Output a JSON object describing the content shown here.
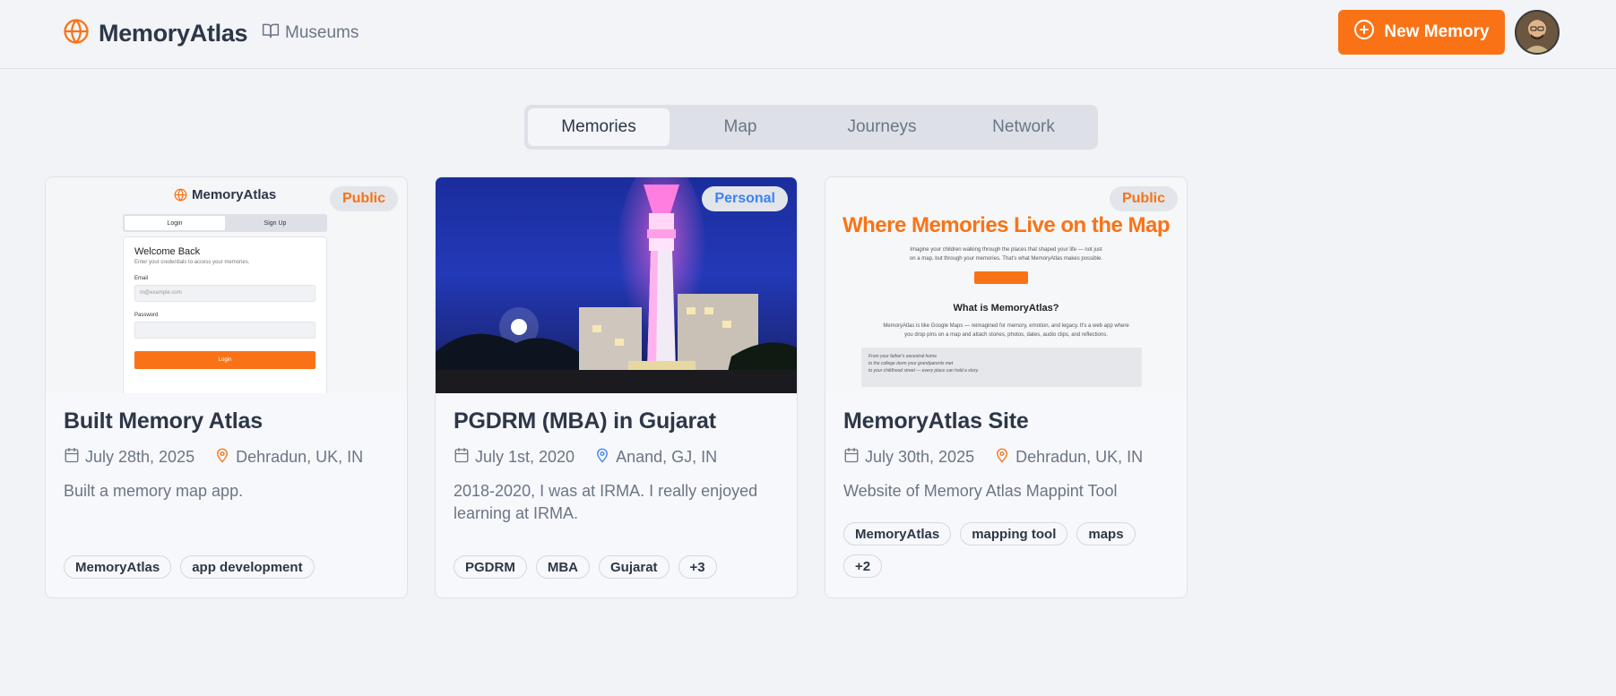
{
  "app": {
    "title": "MemoryAtlas",
    "nav_museums": "Museums",
    "new_memory": "New Memory"
  },
  "tabs": [
    "Memories",
    "Map",
    "Journeys",
    "Network"
  ],
  "active_tab": "Memories",
  "colors": {
    "accent": "#f97316",
    "personal": "#3b82f6"
  },
  "cards": [
    {
      "title": "Built Memory Atlas",
      "date": "July 28th, 2025",
      "location": "Dehradun, UK, IN",
      "description": "Built a memory map app.",
      "visibility": "Public",
      "tags": [
        "MemoryAtlas",
        "app development"
      ],
      "preview": {
        "logo": "MemoryAtlas",
        "tab_login": "Login",
        "tab_signup": "Sign Up",
        "heading": "Welcome Back",
        "subheading": "Enter your credentials to access your memories.",
        "email_label": "Email",
        "email_placeholder": "m@example.com",
        "password_label": "Password",
        "button": "Login"
      }
    },
    {
      "title": "PGDRM (MBA) in Gujarat",
      "date": "July 1st, 2020",
      "location": "Anand, GJ, IN",
      "description": "2018-2020, I was at IRMA. I really enjoyed learning at IRMA.",
      "visibility": "Personal",
      "tags": [
        "PGDRM",
        "MBA",
        "Gujarat",
        "+3"
      ]
    },
    {
      "title": "MemoryAtlas Site",
      "date": "July 30th, 2025",
      "location": "Dehradun, UK, IN",
      "description": "Website of Memory Atlas Mappint Tool",
      "visibility": "Public",
      "tags": [
        "MemoryAtlas",
        "mapping tool",
        "maps",
        "+2"
      ],
      "preview": {
        "hero": "Where Memories Live on the Map",
        "line1": "Imagine your children walking through the places that shaped your life — not just",
        "line2": "on a map, but through your memories. That's what MemoryAtlas makes possible.",
        "section": "What is MemoryAtlas?",
        "body1": "MemoryAtlas is like Google Maps — reimagined for memory, emotion, and legacy. It's a web app where",
        "body2": "you drop pins on a map and attach stories, photos, dates, audio clips, and reflections.",
        "quote1": "From your father's ancestral home",
        "quote2": "to the college dorm your grandparents met",
        "quote3": "to your childhood street — every place can hold a story."
      }
    }
  ]
}
